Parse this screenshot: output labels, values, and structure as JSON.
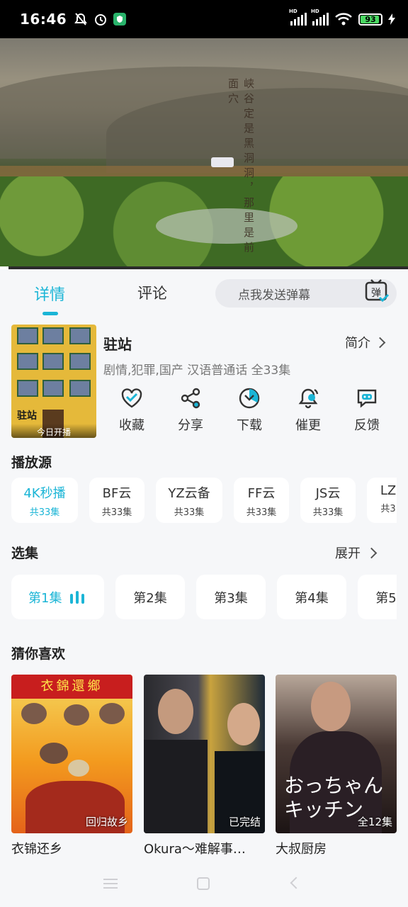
{
  "status_bar": {
    "time": "16:46",
    "battery": "93",
    "network_label": "HD"
  },
  "video": {
    "overlay_text": "峡谷定是黑洞洞，那里是前面穴",
    "progress_fraction": 0.02
  },
  "tabs": {
    "details": "详情",
    "comments": "评论",
    "danmu_placeholder": "点我发送弹幕",
    "danmu_icon_label": "弹"
  },
  "show": {
    "title": "驻站",
    "intro_label": "简介",
    "meta": "剧情,犯罪,国产 汉语普通话 全33集",
    "poster_logo": "驻站",
    "poster_badge": "今日开播"
  },
  "actions": [
    {
      "label": "收藏",
      "icon": "heart-icon"
    },
    {
      "label": "分享",
      "icon": "share-icon"
    },
    {
      "label": "下载",
      "icon": "download-icon"
    },
    {
      "label": "催更",
      "icon": "bell-icon"
    },
    {
      "label": "反馈",
      "icon": "feedback-icon"
    }
  ],
  "sources": {
    "title": "播放源",
    "items": [
      {
        "name": "4K秒播",
        "count": "共33集"
      },
      {
        "name": "BF云",
        "count": "共33集"
      },
      {
        "name": "YZ云备",
        "count": "共33集"
      },
      {
        "name": "FF云",
        "count": "共33集"
      },
      {
        "name": "JS云",
        "count": "共33集"
      },
      {
        "name": "LZ",
        "count": "共3"
      }
    ]
  },
  "episodes": {
    "title": "选集",
    "expand_label": "展开",
    "items": [
      "第1集",
      "第2集",
      "第3集",
      "第4集",
      "第5"
    ]
  },
  "recommend": {
    "title": "猜你喜欢",
    "items": [
      {
        "name": "衣锦还乡",
        "tag": "回归故乡",
        "cover_title": "衣錦還鄉"
      },
      {
        "name": "Okura～难解事…",
        "tag": "已完结"
      },
      {
        "name": "大叔厨房",
        "tag": "全12集",
        "cover_text": "おっちゃん キッチン"
      }
    ]
  },
  "colors": {
    "accent": "#1bb5d6",
    "background": "#f6f7f9"
  }
}
